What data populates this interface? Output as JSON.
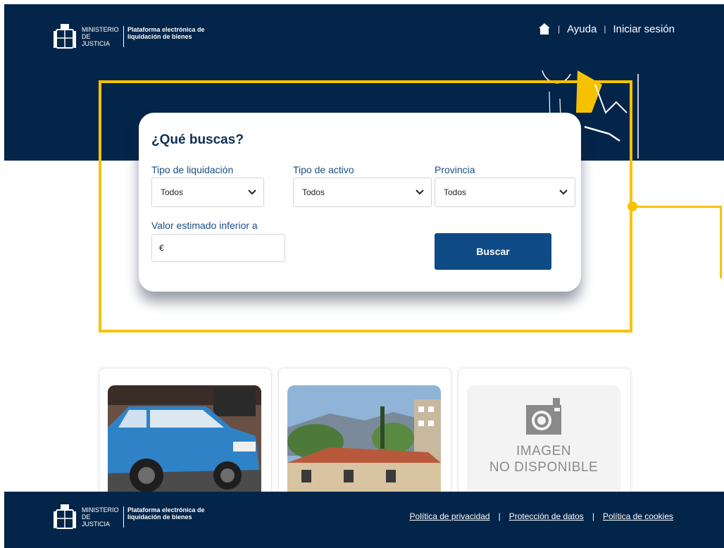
{
  "header": {
    "brand": {
      "ministry": "MINISTERIO DE JUSTICIA",
      "platform": "Plataforma electrónica de liquidación de bienes"
    },
    "nav": {
      "help": "Ayuda",
      "login": "Iniciar sesión",
      "separator": "|"
    }
  },
  "search": {
    "title": "¿Qué buscas?",
    "liquidation_type": {
      "label": "Tipo de liquidación",
      "value": "Todos"
    },
    "asset_type": {
      "label": "Tipo de activo",
      "value": "Todos"
    },
    "province": {
      "label": "Provincia",
      "value": "Todos"
    },
    "estimated_value": {
      "label": "Valor estimado inferior a",
      "value": "€"
    },
    "button": "Buscar"
  },
  "cards": [
    {
      "image": "car-photo"
    },
    {
      "image": "houses-photo"
    },
    {
      "image": "placeholder",
      "placeholder_line1": "IMAGEN",
      "placeholder_line2": "NO DISPONIBLE"
    }
  ],
  "footer": {
    "brand": {
      "ministry": "MINISTERIO DE JUSTICIA",
      "platform": "Plataforma electrónica de liquidación de bienes"
    },
    "links": {
      "privacy": "Política de privacidad",
      "data": "Protección de datos",
      "cookies": "Política de cookies",
      "separator": "|"
    }
  },
  "colors": {
    "navy": "#04254a",
    "accent_blue": "#0e4a86",
    "highlight": "#f6c200",
    "label_blue": "#1a4f86"
  }
}
